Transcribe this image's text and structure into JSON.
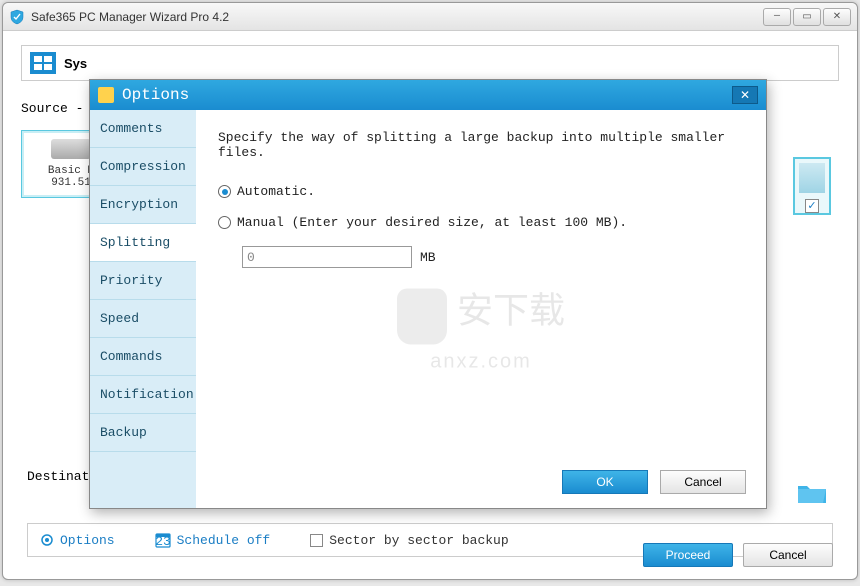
{
  "window": {
    "title": "Safe365 PC Manager Wizard Pro 4.2"
  },
  "main": {
    "toolbar_label": "Sys",
    "source_label": "Source -",
    "disk": {
      "name": "Basic M",
      "size": "931.51"
    },
    "destination_label": "Destinati",
    "options_link": "Options",
    "schedule_link": "Schedule off",
    "sector_label": "Sector by sector backup",
    "proceed": "Proceed",
    "cancel": "Cancel"
  },
  "dialog": {
    "title": "Options",
    "tabs": [
      "Comments",
      "Compression",
      "Encryption",
      "Splitting",
      "Priority",
      "Speed",
      "Commands",
      "Notification",
      "Backup"
    ],
    "active_tab": "Splitting",
    "description": "Specify the way of splitting a large backup into multiple smaller files.",
    "radio_auto": "Automatic.",
    "radio_manual": "Manual (Enter your desired size, at least 100 MB).",
    "size_value": "0",
    "size_unit": "MB",
    "ok": "OK",
    "cancel": "Cancel"
  },
  "watermark": {
    "cn": "安下载",
    "en": "anxz.com"
  }
}
